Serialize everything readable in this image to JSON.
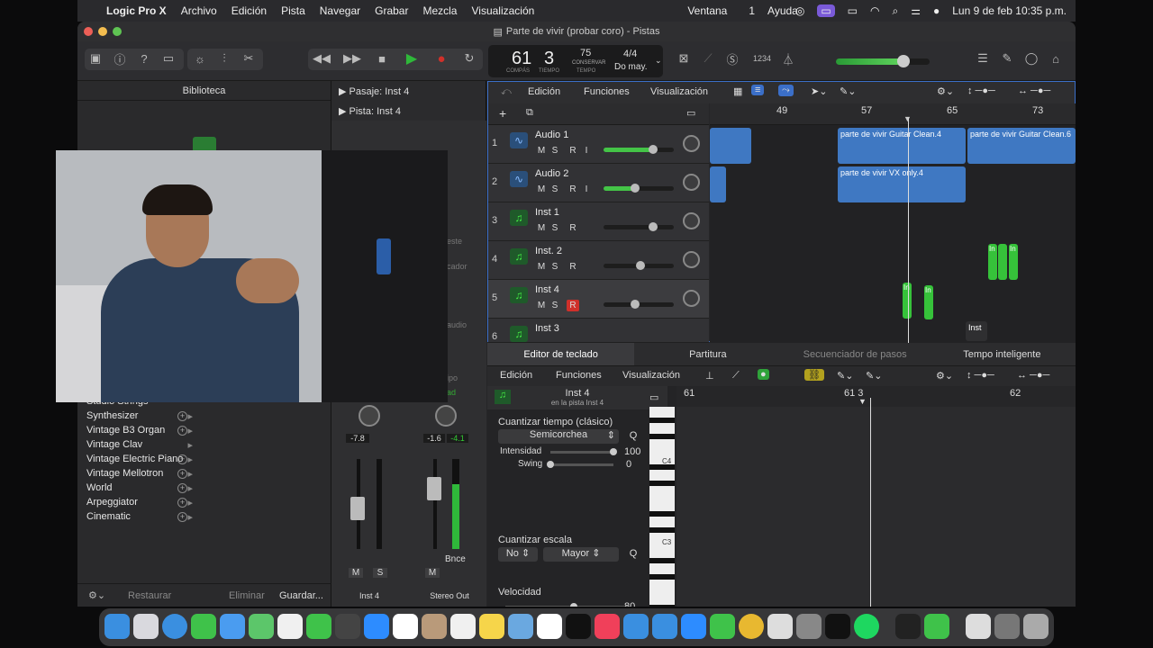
{
  "menubar": {
    "apple": "",
    "app": "Logic Pro X",
    "items": [
      "Archivo",
      "Edición",
      "Pista",
      "Navegar",
      "Grabar",
      "Mezcla",
      "Visualización"
    ],
    "right_items": [
      "Ventana",
      "1",
      "Ayuda"
    ],
    "datetime": "Lun 9 de feb  10:35 p.m."
  },
  "window": {
    "title": "Parte de vivir (probar coro) - Pistas"
  },
  "lcd": {
    "bar": "61",
    "beat": "3",
    "bar_label": "COMPÁS",
    "beat_label": "TIEMPO",
    "tempo": "75",
    "tempo_mode": "CONSERVAR",
    "tempo_label": "TEMPO",
    "signature": "4/4",
    "key": "Do may."
  },
  "toolbar": {
    "count_in": "1234"
  },
  "library": {
    "header": "Biblioteca",
    "items": [
      "Synthesizer",
      "Vintage B3 Organ",
      "Vintage Clav",
      "Vintage Electric Piano",
      "Vintage Mellotron",
      "World",
      "Arpeggiator",
      "Cinematic"
    ],
    "partial_item": "Studio Strings",
    "footer": {
      "restore": "Restaurar",
      "delete": "Eliminar",
      "save": "Guardar..."
    }
  },
  "inspector": {
    "region_label": "Pasaje:",
    "region_name": "Inst 4",
    "track_label": "Pista:",
    "track_name": "Inst 4",
    "partial": [
      "este",
      "cador",
      "audio",
      "ipo",
      "ad"
    ],
    "strip1": {
      "vol": "-7.8",
      "name": "Inst 4",
      "m": "M",
      "s": "S"
    },
    "strip2": {
      "vol": "-1.6",
      "peak": "-4.1",
      "name": "Stereo Out",
      "m": "M",
      "bnce": "Bnce"
    }
  },
  "tracks_bar": {
    "edit": "Edición",
    "functions": "Funciones",
    "view": "Visualización"
  },
  "ruler": [
    "49",
    "57",
    "65",
    "73"
  ],
  "tracks": [
    {
      "num": "1",
      "name": "Audio 1",
      "type": "audio",
      "btns": [
        "M",
        "S",
        "R",
        "I"
      ],
      "level": 0.7
    },
    {
      "num": "2",
      "name": "Audio 2",
      "type": "audio",
      "btns": [
        "M",
        "S",
        "R",
        "I"
      ],
      "level": 0.45
    },
    {
      "num": "3",
      "name": "Inst 1",
      "type": "inst",
      "btns": [
        "M",
        "S",
        "R"
      ],
      "level": 0.7
    },
    {
      "num": "4",
      "name": "Inst. 2",
      "type": "inst",
      "btns": [
        "M",
        "S",
        "R"
      ],
      "level": 0.5
    },
    {
      "num": "5",
      "name": "Inst 4",
      "type": "inst",
      "btns": [
        "M",
        "S",
        "R"
      ],
      "level": 0.45
    },
    {
      "num": "6",
      "name": "Inst 3",
      "type": "inst",
      "btns": [],
      "level": 0
    }
  ],
  "regions": {
    "r1": "parte de vivir Guitar Clean.4",
    "r2": "parte de vivir Guitar Clean.6",
    "r3": "parte de vivir VX only.4",
    "midi": "In",
    "inst": "Inst"
  },
  "editor": {
    "tabs": [
      "Editor de teclado",
      "Partitura",
      "Secuenciador de pasos",
      "Tempo inteligente"
    ],
    "bar": {
      "edit": "Edición",
      "functions": "Funciones",
      "view": "Visualización"
    },
    "region_name": "Inst 4",
    "region_sub": "en la pista Inst 4",
    "quantize_label": "Cuantizar tiempo (clásico)",
    "quantize_value": "Semicorchea",
    "q": "Q",
    "intensity_label": "Intensidad",
    "intensity_value": "100",
    "swing_label": "Swing",
    "swing_value": "0",
    "scale_label": "Cuantizar escala",
    "scale_root": "No",
    "scale_mode": "Mayor",
    "velocity_label": "Velocidad",
    "velocity_value": "80",
    "ruler": [
      "61",
      "61 3",
      "62"
    ],
    "c4": "C4",
    "c3": "C3"
  },
  "colors": {
    "accent": "#3b6fc8",
    "audio_region": "#3f78c2",
    "midi": "#36c23a",
    "record": "#d0302a",
    "play": "#2fb83a"
  }
}
